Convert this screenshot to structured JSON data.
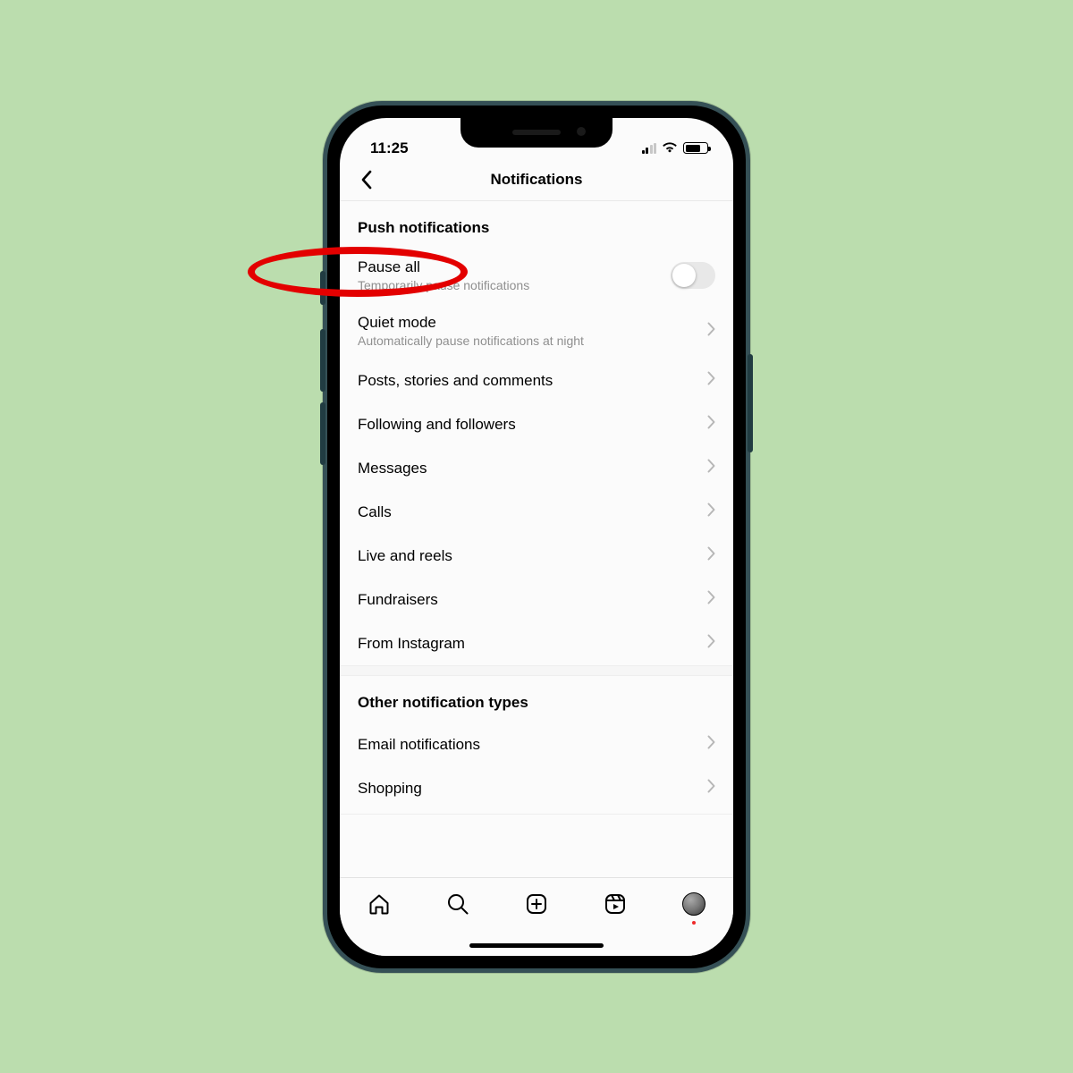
{
  "status": {
    "time": "11:25"
  },
  "header": {
    "title": "Notifications"
  },
  "sections": {
    "push": {
      "title": "Push notifications",
      "pauseAll": {
        "label": "Pause all",
        "sub": "Temporarily pause notifications",
        "on": false
      },
      "quietMode": {
        "label": "Quiet mode",
        "sub": "Automatically pause notifications at night"
      },
      "items": [
        {
          "label": "Posts, stories and comments"
        },
        {
          "label": "Following and followers"
        },
        {
          "label": "Messages"
        },
        {
          "label": "Calls"
        },
        {
          "label": "Live and reels"
        },
        {
          "label": "Fundraisers"
        },
        {
          "label": "From Instagram"
        }
      ]
    },
    "other": {
      "title": "Other notification types",
      "items": [
        {
          "label": "Email notifications"
        },
        {
          "label": "Shopping"
        }
      ]
    }
  },
  "annotation": {
    "target_label": "Quiet mode",
    "shape": "ellipse",
    "color": "#e30000"
  }
}
